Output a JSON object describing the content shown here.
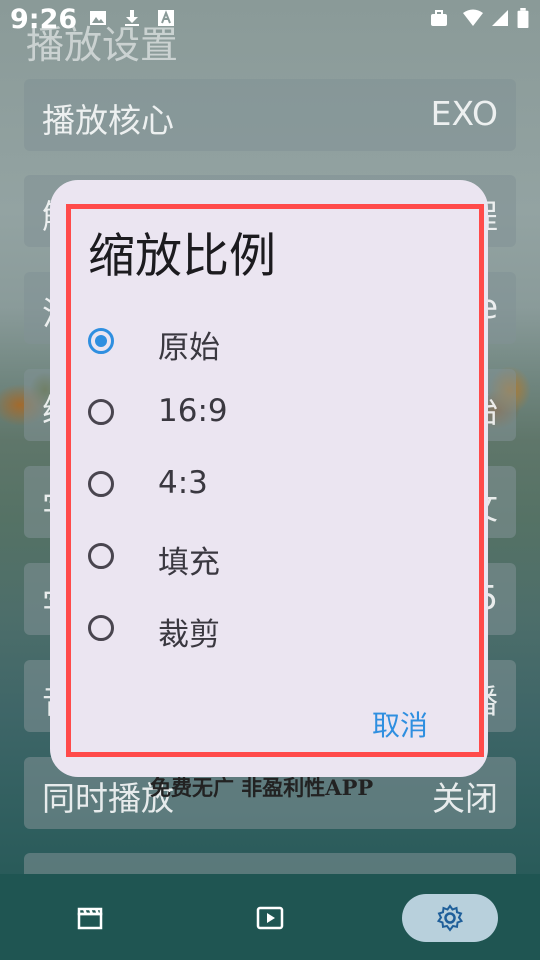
{
  "status_bar": {
    "time": "9:26"
  },
  "background": {
    "title": "播放设置",
    "rows": [
      {
        "label": "播放核心",
        "value": "EXO"
      },
      {
        "label": "解",
        "value": "程"
      },
      {
        "label": "渲",
        "value": "e"
      },
      {
        "label": "缩",
        "value": "始"
      },
      {
        "label": "字",
        "value": "文"
      },
      {
        "label": "字",
        "value": "5"
      },
      {
        "label": "音",
        "value": "播"
      },
      {
        "label": "同时播放",
        "value": "关闭"
      },
      {
        "label": "",
        "value": ""
      }
    ],
    "watermark": "免费无广  非盈利性APP"
  },
  "dialog": {
    "title": "缩放比例",
    "options": [
      {
        "label": "原始",
        "checked": true
      },
      {
        "label": "16:9",
        "checked": false
      },
      {
        "label": "4:3",
        "checked": false
      },
      {
        "label": "填充",
        "checked": false
      },
      {
        "label": "裁剪",
        "checked": false
      }
    ],
    "cancel_label": "取消"
  },
  "bottom_nav": [
    {
      "icon": "clapperboard-icon",
      "active": false
    },
    {
      "icon": "play-icon",
      "active": false
    },
    {
      "icon": "gear-icon",
      "active": true
    }
  ],
  "colors": {
    "accent": "#2f8fe0",
    "dialog_bg": "#ebe5f1",
    "highlight": "#ff4a4a"
  }
}
